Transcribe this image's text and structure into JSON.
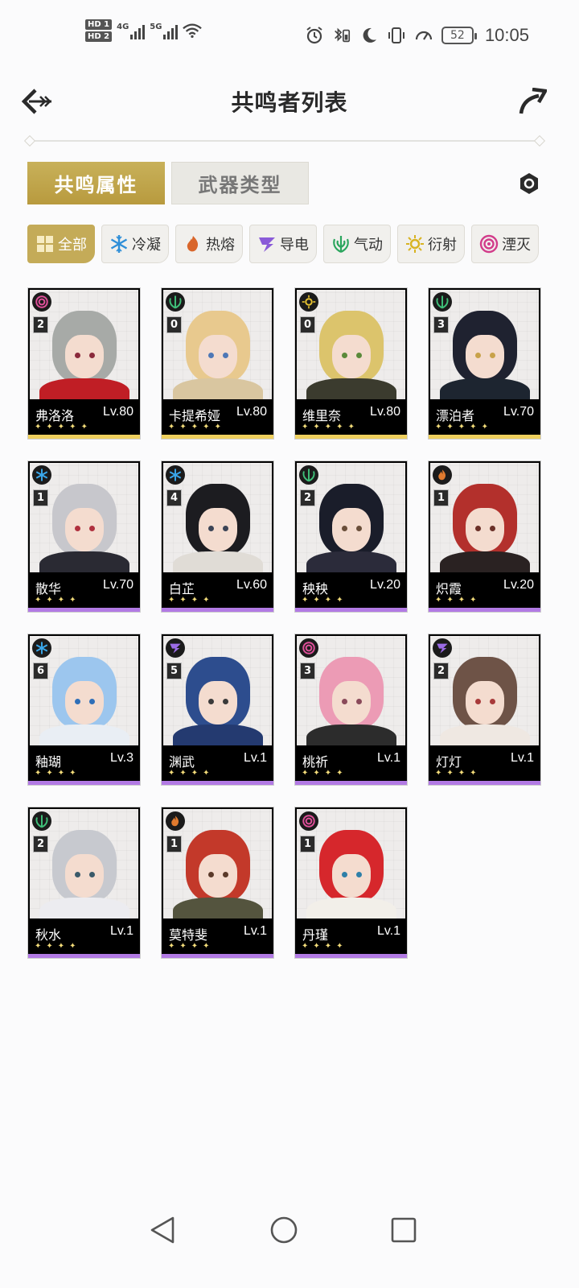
{
  "status_bar": {
    "hd1": "HD 1",
    "hd2": "HD 2",
    "net1": "4G",
    "net2": "5G",
    "battery": "52",
    "time": "10:05"
  },
  "header": {
    "title": "共鸣者列表"
  },
  "category_tabs": [
    {
      "label": "共鸣属性",
      "active": true
    },
    {
      "label": "武器类型",
      "active": false
    }
  ],
  "element_filters": [
    {
      "label": "全部",
      "icon": "grid-icon",
      "color": "#ffffff",
      "active": true
    },
    {
      "label": "冷凝",
      "icon": "snowflake-icon",
      "color": "#2f8fd8"
    },
    {
      "label": "热熔",
      "icon": "flame-icon",
      "color": "#d9662b"
    },
    {
      "label": "导电",
      "icon": "lightning-icon",
      "color": "#8a5bd8"
    },
    {
      "label": "气动",
      "icon": "wind-icon",
      "color": "#2aa55d"
    },
    {
      "label": "衍射",
      "icon": "sun-icon",
      "color": "#d8b322"
    },
    {
      "label": "湮灭",
      "icon": "havoc-swirl-icon",
      "color": "#d23c8a"
    }
  ],
  "characters": [
    {
      "name": "弗洛洛",
      "level": "Lv.80",
      "sequence": "2",
      "element": "havoc",
      "rarity": 5,
      "hair": "#a7aaa7",
      "body": "#c01e25",
      "eye": "#8a2a3c"
    },
    {
      "name": "卡提希娅",
      "level": "Lv.80",
      "sequence": "0",
      "element": "aero",
      "rarity": 5,
      "hair": "#e8c98e",
      "body": "#d9c6a0",
      "eye": "#4e78b6"
    },
    {
      "name": "维里奈",
      "level": "Lv.80",
      "sequence": "0",
      "element": "spectro",
      "rarity": 5,
      "hair": "#dcc46c",
      "body": "#3b3b2e",
      "eye": "#5a8a3a"
    },
    {
      "name": "漂泊者",
      "level": "Lv.70",
      "sequence": "3",
      "element": "aero",
      "rarity": 5,
      "hair": "#1f2230",
      "body": "#1d2530",
      "eye": "#c8a24a"
    },
    {
      "name": "散华",
      "level": "Lv.70",
      "sequence": "1",
      "element": "glacio",
      "rarity": 4,
      "hair": "#c7c7cc",
      "body": "#2a2a33",
      "eye": "#b0303e"
    },
    {
      "name": "白芷",
      "level": "Lv.60",
      "sequence": "4",
      "element": "glacio",
      "rarity": 4,
      "hair": "#1c1c20",
      "body": "#e0dcd6",
      "eye": "#3b4456"
    },
    {
      "name": "秧秧",
      "level": "Lv.20",
      "sequence": "2",
      "element": "aero",
      "rarity": 4,
      "hair": "#1a1d2a",
      "body": "#2b2b3a",
      "eye": "#6a4f3a"
    },
    {
      "name": "炽霞",
      "level": "Lv.20",
      "sequence": "1",
      "element": "fusion",
      "rarity": 4,
      "hair": "#b3302c",
      "body": "#2a2222",
      "eye": "#6b3028"
    },
    {
      "name": "釉瑚",
      "level": "Lv.3",
      "sequence": "6",
      "element": "glacio",
      "rarity": 4,
      "hair": "#9cc6ee",
      "body": "#e9eef4",
      "eye": "#2f6fb8"
    },
    {
      "name": "渊武",
      "level": "Lv.1",
      "sequence": "5",
      "element": "electro",
      "rarity": 4,
      "hair": "#2d4d8e",
      "body": "#243a70",
      "eye": "#3a3a3a"
    },
    {
      "name": "桃祈",
      "level": "Lv.1",
      "sequence": "3",
      "element": "havoc",
      "rarity": 4,
      "hair": "#ec9bb5",
      "body": "#2c2c2c",
      "eye": "#8a4a5a"
    },
    {
      "name": "灯灯",
      "level": "Lv.1",
      "sequence": "2",
      "element": "electro",
      "rarity": 4,
      "hair": "#6e5347",
      "body": "#efe8e2",
      "eye": "#a83a3a"
    },
    {
      "name": "秋水",
      "level": "Lv.1",
      "sequence": "2",
      "element": "aero",
      "rarity": 4,
      "hair": "#c7c9cf",
      "body": "#ececf0",
      "eye": "#3a5a6a"
    },
    {
      "name": "莫特斐",
      "level": "Lv.1",
      "sequence": "1",
      "element": "fusion",
      "rarity": 4,
      "hair": "#c3392a",
      "body": "#54543e",
      "eye": "#5a3a2a"
    },
    {
      "name": "丹瑾",
      "level": "Lv.1",
      "sequence": "1",
      "element": "havoc",
      "rarity": 4,
      "hair": "#d6272c",
      "body": "#f2efe9",
      "eye": "#2e7fa8"
    }
  ],
  "element_colors": {
    "glacio": "#3aa7ea",
    "fusion": "#e07a2e",
    "electro": "#9b6be6",
    "aero": "#3fbf78",
    "spectro": "#e6c231",
    "havoc": "#e0509a"
  },
  "nav": {
    "back": "triangle-back-icon",
    "home": "circle-home-icon",
    "recents": "square-recents-icon"
  }
}
